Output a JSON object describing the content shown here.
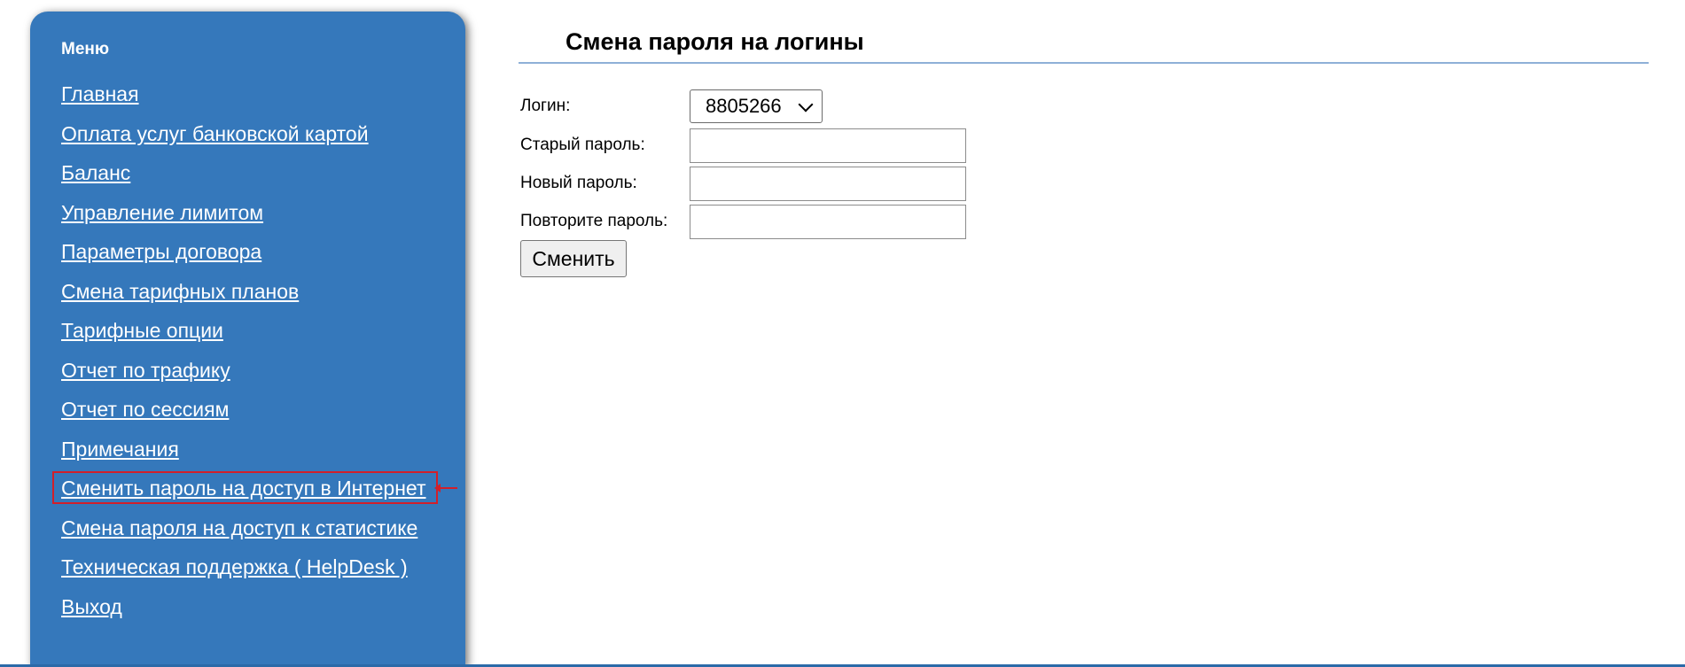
{
  "sidebar": {
    "title": "Меню",
    "items": [
      {
        "label": "Главная"
      },
      {
        "label": "Оплата услуг банковской картой"
      },
      {
        "label": "Баланс"
      },
      {
        "label": "Управление лимитом"
      },
      {
        "label": "Параметры договора"
      },
      {
        "label": "Смена тарифных планов"
      },
      {
        "label": "Тарифные опции"
      },
      {
        "label": "Отчет по трафику"
      },
      {
        "label": "Отчет по сессиям"
      },
      {
        "label": "Примечания"
      },
      {
        "label": "Сменить пароль на доступ в Интернет",
        "highlighted": true
      },
      {
        "label": "Смена пароля на доступ к статистике"
      },
      {
        "label": "Техническая поддержка ( HelpDesk )"
      },
      {
        "label": "Выход"
      }
    ]
  },
  "main": {
    "title": "Смена пароля на логины",
    "form": {
      "login_label": "Логин:",
      "login_value": "8805266",
      "old_password_label": "Старый пароль:",
      "old_password_value": "",
      "new_password_label": "Новый пароль:",
      "new_password_value": "",
      "repeat_password_label": "Повторите пароль:",
      "repeat_password_value": "",
      "submit_label": "Сменить"
    }
  },
  "colors": {
    "sidebar_bg": "#3578bb",
    "highlight": "#d21f2a",
    "rule": "#8eb0d7"
  },
  "icons": {
    "select_arrow": "chevron-down-icon",
    "pointer_arrow": "arrow-left-icon"
  }
}
